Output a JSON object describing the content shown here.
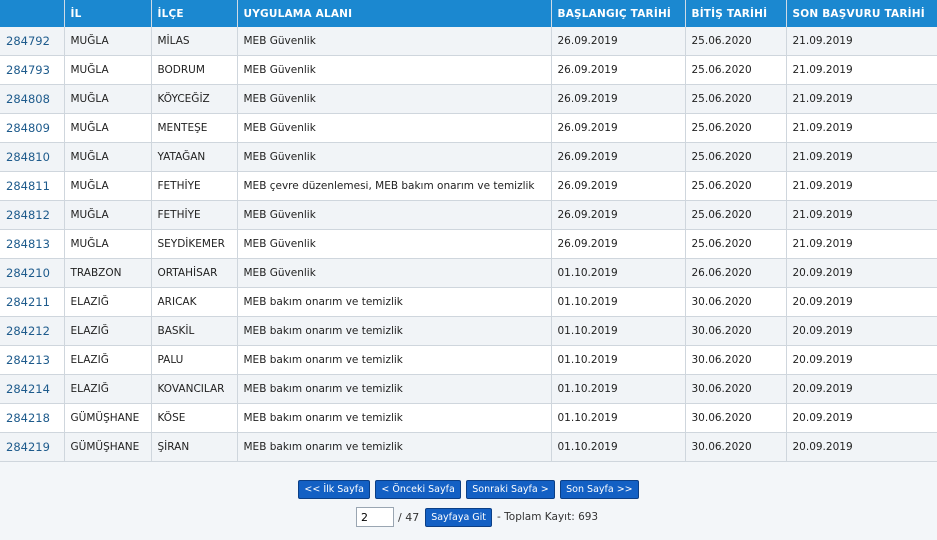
{
  "table": {
    "headers": [
      "",
      "İL",
      "İLÇE",
      "UYGULAMA ALANI",
      "BAŞLANGIÇ TARİHİ",
      "BİTİŞ TARİHİ",
      "SON BAŞVURU TARİHİ"
    ],
    "rows": [
      {
        "id": "284792",
        "il": "MUĞLA",
        "ilce": "MİLAS",
        "alan": "MEB Güvenlik",
        "baslangic": "26.09.2019",
        "bitis": "25.06.2020",
        "son": "21.09.2019"
      },
      {
        "id": "284793",
        "il": "MUĞLA",
        "ilce": "BODRUM",
        "alan": "MEB Güvenlik",
        "baslangic": "26.09.2019",
        "bitis": "25.06.2020",
        "son": "21.09.2019"
      },
      {
        "id": "284808",
        "il": "MUĞLA",
        "ilce": "KÖYCEĞİZ",
        "alan": "MEB Güvenlik",
        "baslangic": "26.09.2019",
        "bitis": "25.06.2020",
        "son": "21.09.2019"
      },
      {
        "id": "284809",
        "il": "MUĞLA",
        "ilce": "MENTEŞE",
        "alan": "MEB Güvenlik",
        "baslangic": "26.09.2019",
        "bitis": "25.06.2020",
        "son": "21.09.2019"
      },
      {
        "id": "284810",
        "il": "MUĞLA",
        "ilce": "YATAĞAN",
        "alan": "MEB Güvenlik",
        "baslangic": "26.09.2019",
        "bitis": "25.06.2020",
        "son": "21.09.2019"
      },
      {
        "id": "284811",
        "il": "MUĞLA",
        "ilce": "FETHİYE",
        "alan": "MEB çevre düzenlemesi, MEB bakım onarım ve temizlik",
        "baslangic": "26.09.2019",
        "bitis": "25.06.2020",
        "son": "21.09.2019"
      },
      {
        "id": "284812",
        "il": "MUĞLA",
        "ilce": "FETHİYE",
        "alan": "MEB Güvenlik",
        "baslangic": "26.09.2019",
        "bitis": "25.06.2020",
        "son": "21.09.2019"
      },
      {
        "id": "284813",
        "il": "MUĞLA",
        "ilce": "SEYDİKEMER",
        "alan": "MEB Güvenlik",
        "baslangic": "26.09.2019",
        "bitis": "25.06.2020",
        "son": "21.09.2019"
      },
      {
        "id": "284210",
        "il": "TRABZON",
        "ilce": "ORTAHİSAR",
        "alan": "MEB Güvenlik",
        "baslangic": "01.10.2019",
        "bitis": "26.06.2020",
        "son": "20.09.2019"
      },
      {
        "id": "284211",
        "il": "ELAZIĞ",
        "ilce": "ARICAK",
        "alan": "MEB bakım onarım ve temizlik",
        "baslangic": "01.10.2019",
        "bitis": "30.06.2020",
        "son": "20.09.2019"
      },
      {
        "id": "284212",
        "il": "ELAZIĞ",
        "ilce": "BASKİL",
        "alan": "MEB bakım onarım ve temizlik",
        "baslangic": "01.10.2019",
        "bitis": "30.06.2020",
        "son": "20.09.2019"
      },
      {
        "id": "284213",
        "il": "ELAZIĞ",
        "ilce": "PALU",
        "alan": "MEB bakım onarım ve temizlik",
        "baslangic": "01.10.2019",
        "bitis": "30.06.2020",
        "son": "20.09.2019"
      },
      {
        "id": "284214",
        "il": "ELAZIĞ",
        "ilce": "KOVANCILAR",
        "alan": "MEB bakım onarım ve temizlik",
        "baslangic": "01.10.2019",
        "bitis": "30.06.2020",
        "son": "20.09.2019"
      },
      {
        "id": "284218",
        "il": "GÜMÜŞHANE",
        "ilce": "KÖSE",
        "alan": "MEB bakım onarım ve temizlik",
        "baslangic": "01.10.2019",
        "bitis": "30.06.2020",
        "son": "20.09.2019"
      },
      {
        "id": "284219",
        "il": "GÜMÜŞHANE",
        "ilce": "ŞİRAN",
        "alan": "MEB bakım onarım ve temizlik",
        "baslangic": "01.10.2019",
        "bitis": "30.06.2020",
        "son": "20.09.2019"
      }
    ]
  },
  "pager": {
    "first_label": "<< İlk Sayfa",
    "prev_label": "< Önceki Sayfa",
    "next_label": "Sonraki Sayfa >",
    "last_label": "Son Sayfa >>",
    "current_page": "2",
    "total_pages": "/ 47",
    "goto_label": "Sayfaya Git",
    "total_records": "- Toplam Kayıt: 693"
  },
  "colors": {
    "header_bg": "#1b88d0",
    "button_bg": "#1360c4",
    "link": "#1e5b8c"
  }
}
